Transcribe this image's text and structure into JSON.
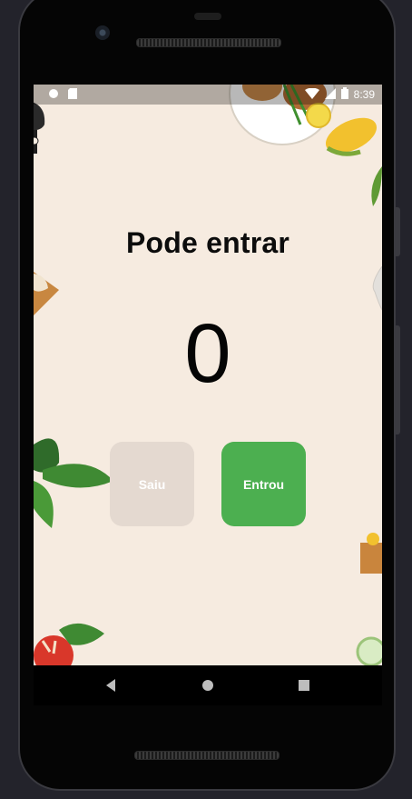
{
  "status_bar": {
    "time": "8:39",
    "left_icons": [
      "circle-icon",
      "sim-card-icon"
    ],
    "right_icons": [
      "wifi-icon",
      "signal-icon",
      "battery-icon"
    ]
  },
  "main": {
    "title": "Pode entrar",
    "counter": "0",
    "buttons": {
      "saiu": "Saiu",
      "entrou": "Entrou"
    }
  },
  "nav_bar": {
    "items": [
      "back-icon",
      "home-icon",
      "recents-icon"
    ]
  },
  "colors": {
    "background": "#f6ebe0",
    "saiu_button": "#e4d9d0",
    "entrou_button": "#4caf50",
    "text": "#0c0c0c"
  }
}
